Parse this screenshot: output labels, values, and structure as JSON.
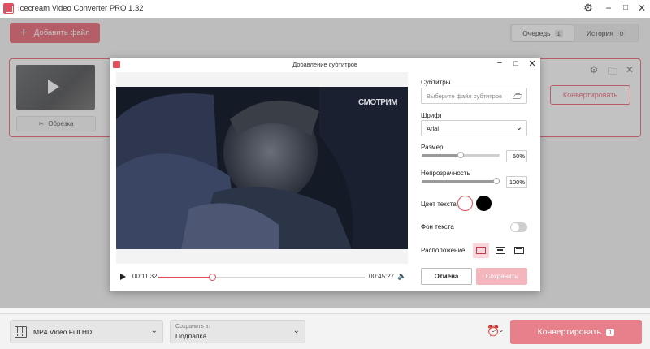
{
  "app": {
    "title": "Icecream Video Converter PRO 1.32",
    "add_file_label": "Добавить файл",
    "tabs": [
      {
        "label": "Очередь",
        "count": "1"
      },
      {
        "label": "История",
        "count": "0"
      }
    ],
    "file_card": {
      "trim_label": "Обрезка",
      "convert_label": "Конвертировать"
    },
    "bottom": {
      "format_value": "MP4 Video Full HD",
      "save_to_label": "Сохранить в:",
      "save_to_value": "Подпапка",
      "convert_label": "Конвертировать",
      "convert_count": "1"
    }
  },
  "dialog": {
    "title": "Добавление субтитров",
    "watermark": "СМОТРИМ",
    "player": {
      "current_time": "00:11:32",
      "total_time": "00:45:27",
      "progress": 0.26
    },
    "subtitles": {
      "label": "Субтитры",
      "placeholder": "Выберите файл субтитров"
    },
    "font": {
      "label": "Шрифт",
      "value": "Arial"
    },
    "size": {
      "label": "Размер",
      "value": "50%",
      "level": 0.5
    },
    "opacity": {
      "label": "Непрозрачность",
      "value": "100%",
      "level": 1.0
    },
    "text_color": {
      "label": "Цвет текста",
      "colors": [
        "#ffffff",
        "#000000"
      ]
    },
    "text_background": {
      "label": "Фон текста"
    },
    "position": {
      "label": "Расположение",
      "options": [
        "bottom",
        "middle",
        "top"
      ]
    },
    "cancel_label": "Отмена",
    "save_label": "Сохранить"
  },
  "colors": {
    "accent": "#e8495a"
  }
}
